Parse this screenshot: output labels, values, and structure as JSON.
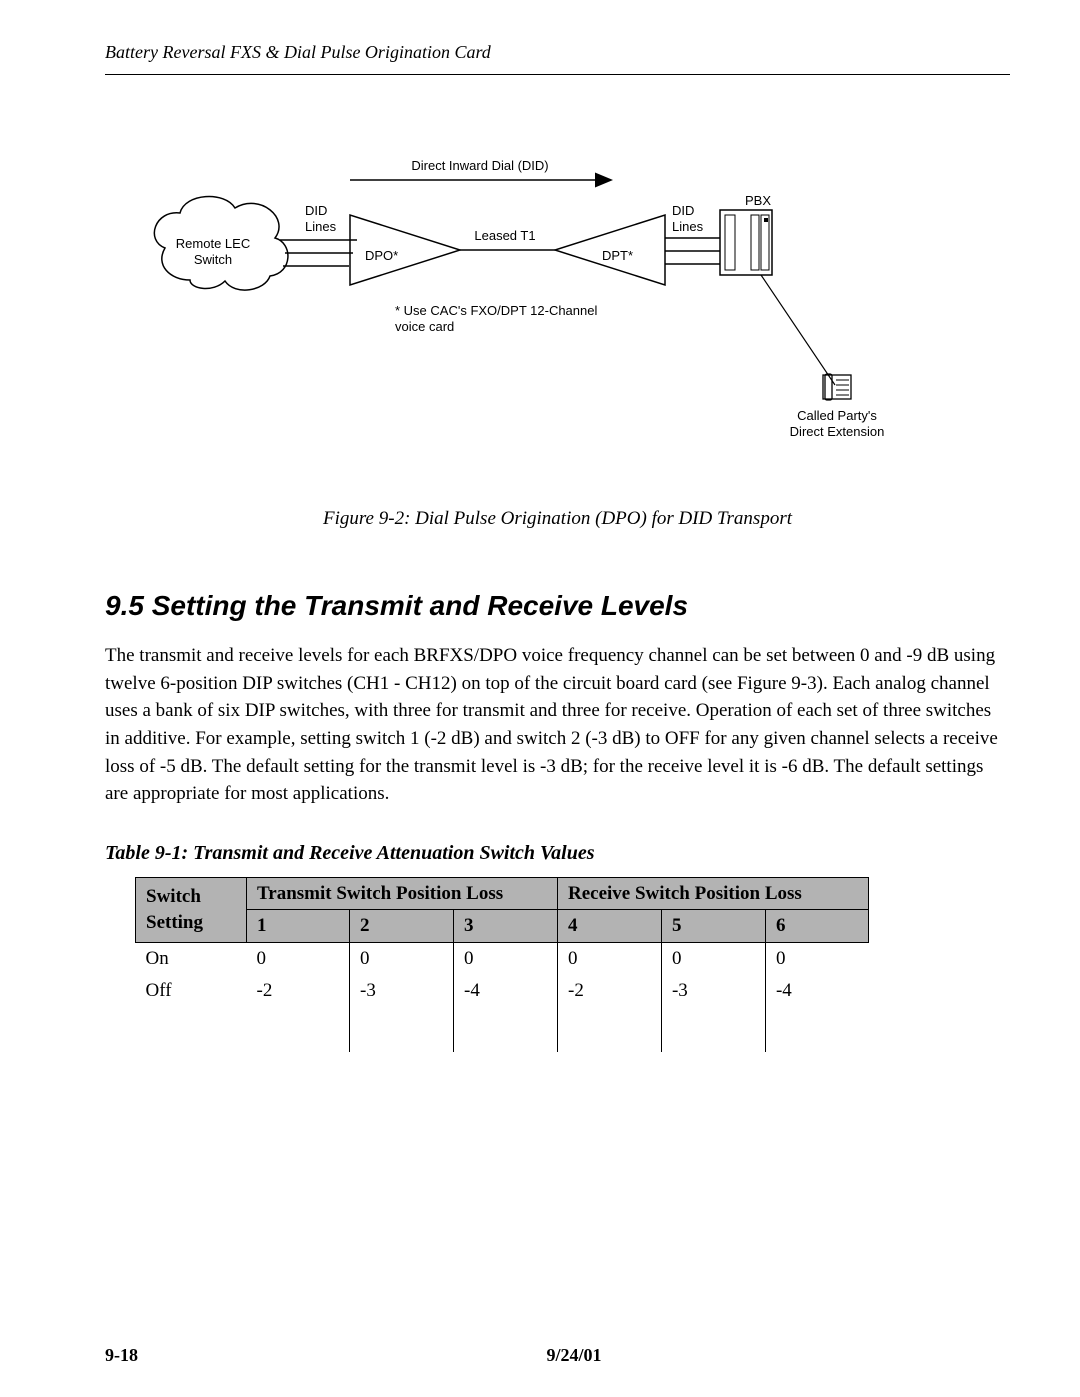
{
  "header": {
    "running_head": "Battery Reversal FXS & Dial Pulse Origination Card"
  },
  "figure": {
    "caption": "Figure 9-2: Dial Pulse Origination (DPO) for DID Transport",
    "labels": {
      "did_top": "Direct Inward Dial (DID)",
      "remote_lec_switch_1": "Remote LEC",
      "remote_lec_switch_2": "Switch",
      "did_lines_left_1": "DID",
      "did_lines_left_2": "Lines",
      "dpo": "DPO*",
      "leased_t1": "Leased T1",
      "dpt": "DPT*",
      "did_lines_right_1": "DID",
      "did_lines_right_2": "Lines",
      "pbx": "PBX",
      "footnote_1": "* Use CAC's FXO/DPT 12-Channel",
      "footnote_2": "voice card",
      "called_party_1": "Called Party's",
      "called_party_2": "Direct Extension"
    }
  },
  "section": {
    "heading": "9.5   Setting the Transmit and Receive Levels",
    "body": "The transmit and receive levels for each BRFXS/DPO voice frequency channel can be set between 0 and -9 dB using twelve 6-position DIP switches (CH1 - CH12) on top of the circuit board card (see Figure 9-3). Each analog channel uses a bank of six DIP switches, with three for transmit and three for receive. Operation of each set of three switches in additive. For example, setting switch 1 (-2 dB) and switch 2 (-3 dB) to OFF for any given channel selects a receive loss of -5 dB. The default setting for the transmit level is -3 dB; for the receive level it is -6 dB. The default settings are appropriate for most applications."
  },
  "table": {
    "caption": "Table 9-1: Transmit and Receive Attenuation Switch Values",
    "head": {
      "switch_setting_1": "Switch",
      "switch_setting_2": "Setting",
      "tx_group": "Transmit Switch Position Loss",
      "rx_group": "Receive Switch Position Loss",
      "c1": "1",
      "c2": "2",
      "c3": "3",
      "c4": "4",
      "c5": "5",
      "c6": "6"
    },
    "rows": [
      {
        "setting": "On",
        "v": [
          "0",
          "0",
          "0",
          "0",
          "0",
          "0"
        ]
      },
      {
        "setting": "Off",
        "v": [
          "-2",
          "-3",
          "-4",
          "-2",
          "-3",
          "-4"
        ]
      }
    ]
  },
  "footer": {
    "page_number": "9-18",
    "date": "9/24/01"
  }
}
